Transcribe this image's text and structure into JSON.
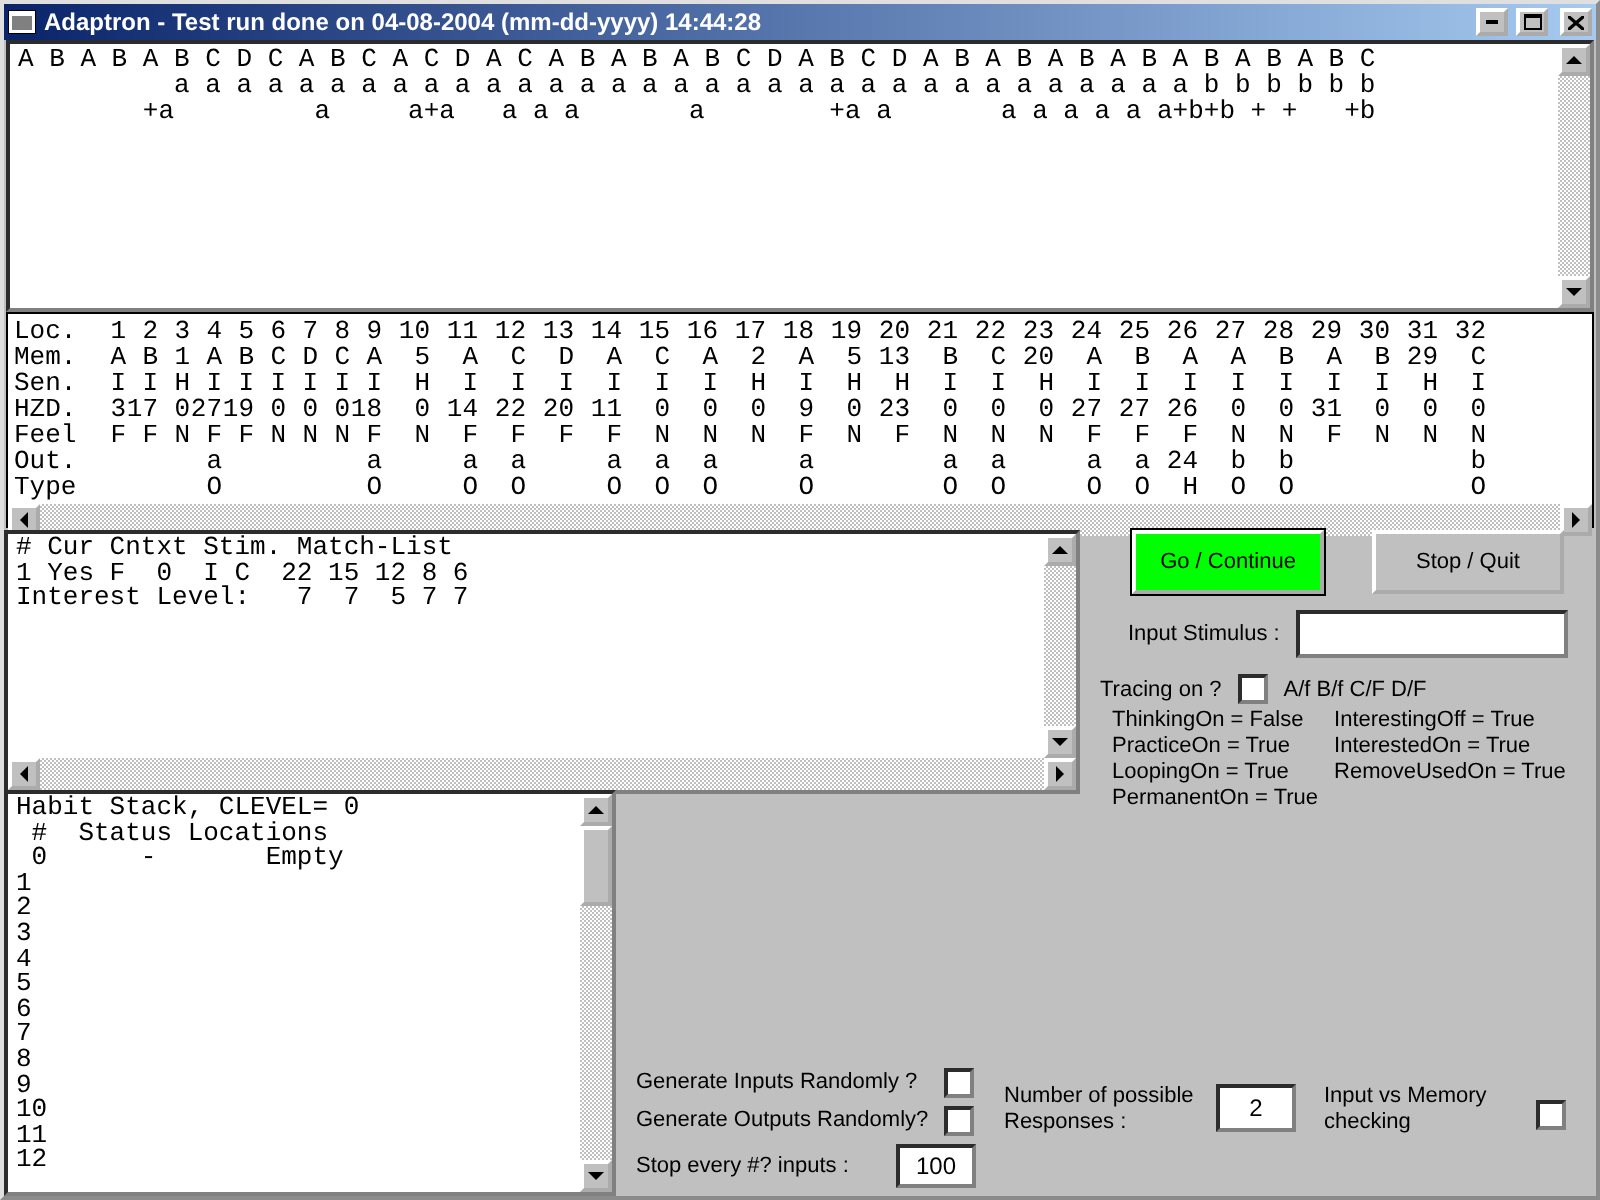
{
  "window": {
    "title": "Adaptron - Test run done on 04-08-2004 (mm-dd-yyyy) 14:44:28"
  },
  "sequence_panel": {
    "lines": [
      "A B A B A B C D C A B C A C D A C A B A B A B C D A B C D A B A B A B A B A B A B A B C",
      "          a a a a a a a a a a a a a a a a a a a a a a a a a a a a a a a a a b b b b b b",
      "        +a         a     a+a   a a a       a        +a a       a a a a a a+b+b + +   +b"
    ]
  },
  "memory_table": {
    "rows": [
      {
        "label": "Loc.",
        "cells": [
          "1",
          "2",
          "3",
          "4",
          "5",
          "6",
          "7",
          "8",
          "9",
          "10",
          "11",
          "12",
          "13",
          "14",
          "15",
          "16",
          "17",
          "18",
          "19",
          "20",
          "21",
          "22",
          "23",
          "24",
          "25",
          "26",
          "27",
          "28",
          "29",
          "30",
          "31",
          "32"
        ]
      },
      {
        "label": "Mem.",
        "cells": [
          "A",
          "B",
          "1",
          "A",
          "B",
          "C",
          "D",
          "C",
          "A",
          "5",
          "A",
          "C",
          "D",
          "A",
          "C",
          "A",
          "2",
          "A",
          "5",
          "13",
          "B",
          "C",
          "20",
          "A",
          "B",
          "A",
          "A",
          "B",
          "A",
          "B",
          "29",
          "C"
        ]
      },
      {
        "label": "Sen.",
        "cells": [
          "I",
          "I",
          "H",
          "I",
          "I",
          "I",
          "I",
          "I",
          "I",
          "H",
          "I",
          "I",
          "I",
          "I",
          "I",
          "I",
          "H",
          "I",
          "H",
          "H",
          "I",
          "I",
          "H",
          "I",
          "I",
          "I",
          "I",
          "I",
          "I",
          "I",
          "H",
          "I"
        ]
      },
      {
        "label": "HZD.",
        "cells": [
          "3",
          "17",
          "0",
          "27",
          "19",
          "0",
          "0",
          "0",
          "18",
          "0",
          "14",
          "22",
          "20",
          "11",
          "0",
          "0",
          "0",
          "9",
          "0",
          "23",
          "0",
          "0",
          "0",
          "27",
          "27",
          "26",
          "0",
          "0",
          "31",
          "0",
          "0",
          "0"
        ]
      },
      {
        "label": "Feel",
        "cells": [
          "F",
          "F",
          "N",
          "F",
          "F",
          "N",
          "N",
          "N",
          "F",
          "N",
          "F",
          "F",
          "F",
          "F",
          "N",
          "N",
          "N",
          "F",
          "N",
          "F",
          "N",
          "N",
          "N",
          "F",
          "F",
          "F",
          "N",
          "N",
          "F",
          "N",
          "N",
          "N"
        ]
      },
      {
        "label": "Out.",
        "cells": [
          null,
          null,
          null,
          "a",
          null,
          null,
          null,
          null,
          "a",
          null,
          "a",
          "a",
          null,
          "a",
          "a",
          "a",
          null,
          "a",
          null,
          null,
          "a",
          "a",
          null,
          "a",
          "a",
          "24",
          "b",
          "b",
          null,
          null,
          null,
          "b"
        ]
      },
      {
        "label": "Type",
        "cells": [
          null,
          null,
          null,
          "O",
          null,
          null,
          null,
          null,
          "O",
          null,
          "O",
          "O",
          null,
          "O",
          "O",
          "O",
          null,
          "O",
          null,
          null,
          "O",
          "O",
          null,
          "O",
          "O",
          "H",
          "O",
          "O",
          null,
          null,
          null,
          "O"
        ]
      }
    ]
  },
  "match_panel": {
    "lines": [
      "# Cur Cntxt Stim. Match-List",
      "1 Yes F  0  I C  22 15 12 8 6",
      "Interest Level:   7  7  5 7 7"
    ]
  },
  "habit_panel": {
    "lines": [
      "Habit Stack, CLEVEL= 0",
      " #  Status Locations",
      " 0      -       Empty",
      "1",
      "2",
      "3",
      "4",
      "5",
      "6",
      "7",
      "8",
      "9",
      "10",
      "11",
      "12"
    ]
  },
  "buttons": [
    {
      "label": "Go / Continue",
      "kind": "primary"
    },
    {
      "label": "Stop / Quit",
      "kind": "normal"
    }
  ],
  "input_stimulus": {
    "label": "Input Stimulus :"
  },
  "tracing": {
    "label": "Tracing on ?",
    "checked": false,
    "options": "A/f  B/f  C/F  D/F"
  },
  "status_lines": [
    "ThinkingOn = False",
    "InterestingOff = True",
    "PracticeOn = True",
    "InterestedOn = True",
    "LoopingOn = True",
    "RemoveUsedOn = True",
    "PermanentOn = True"
  ],
  "options": {
    "generate_inputs": {
      "label": "Generate Inputs Randomly ?",
      "checked": false
    },
    "generate_outputs": {
      "label": "Generate Outputs Randomly?",
      "checked": false
    },
    "stop_every": {
      "label": "Stop every #? inputs :",
      "value": "100"
    },
    "responses": {
      "label": "Number of possible Responses :",
      "value": "2"
    },
    "input_vs_memory": {
      "label": "Input vs Memory checking",
      "checked": false
    }
  }
}
